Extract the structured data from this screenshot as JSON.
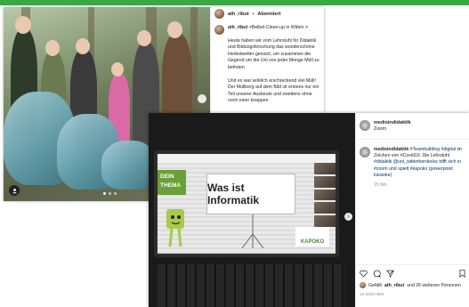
{
  "colors": {
    "accent_green": "#3aa845",
    "link": "#00376b",
    "muted": "#8e8e8e"
  },
  "post_back": {
    "username": "ath_ribut",
    "separator": "•",
    "follow_label": "Abonniert",
    "caption_user": "ath_ribut",
    "caption_first": "Belbel-Clean-up in Witten",
    "caption_paragraphs": [
      "Heute haben wir vom Lehrstuhl für Didaktik und Bildungsforschung das wunderschöne Herbstwetter genutzt, um zusammen die Gegend um die Uni von jeder Menge Müll zu befreien",
      "Und es war wirklich erschreckend viel Müll! Der Müllberg auf dem Bild ist erstens nur ein Teil unserer Ausbeute und zweitens ohne noch einer knappen"
    ]
  },
  "post_front": {
    "username": "medisindidaktik",
    "subtitle": "Zoom",
    "caption_user": "medisindidaktik",
    "hashtags": "#Teambuilding #digital",
    "caption_text": "im Zeichen von #Covid19. Die Lehrstuhl",
    "caption_tail": "#didaktik @uni_wittenherdecke trifft sich in #zoom und spielt #kapoko (powerpoint karaoke)",
    "age": "15 Wo.",
    "likes_prefix": "Gefällt",
    "likes_user": "ath_ribut",
    "likes_suffix": "und 26 weiteren Personen",
    "time_ago": "15 WOCHEN"
  },
  "slide": {
    "badge_line1": "DEIN",
    "badge_line2": "THEMA",
    "title": "Was ist Informatik",
    "logo_text": "KAPOKO"
  },
  "icons": [
    "user-tag-icon",
    "next-arrow-icon",
    "heart-icon",
    "comment-icon",
    "share-icon",
    "bookmark-icon"
  ]
}
